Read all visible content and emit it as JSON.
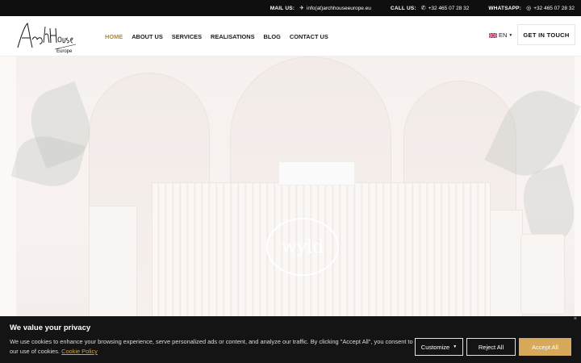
{
  "topbar": {
    "mail_label": "MAIL US:",
    "mail_value": "info(at)archhouseeurope.eu",
    "call_label": "CALL US:",
    "call_value": "+32 465 07 28 32",
    "whatsapp_label": "WHATSAPP:",
    "whatsapp_value": "+32 465 07 28 32"
  },
  "header": {
    "logo_text": "Arch House Europe",
    "nav": [
      "HOME",
      "ABOUT US",
      "SERVICES",
      "REALISATIONS",
      "BLOG",
      "CONTACT US"
    ],
    "active_index": 0,
    "language": "EN",
    "cta_label": "GET IN TOUCH"
  },
  "hero": {
    "sign_text": "wyld"
  },
  "cookie": {
    "title": "We value your privacy",
    "text": "We use cookies to enhance your browsing experience, serve personalized ads or content, and analyze our traffic. By clicking \"Accept All\", you consent to our use of cookies.",
    "link": "Cookie Policy",
    "customize": "Customize",
    "reject": "Reject All",
    "accept": "Accept All",
    "close": "×"
  },
  "colors": {
    "accent": "#b08b3e",
    "accept_button": "#d6a95b",
    "topbar_bg": "#0f0f0f"
  }
}
